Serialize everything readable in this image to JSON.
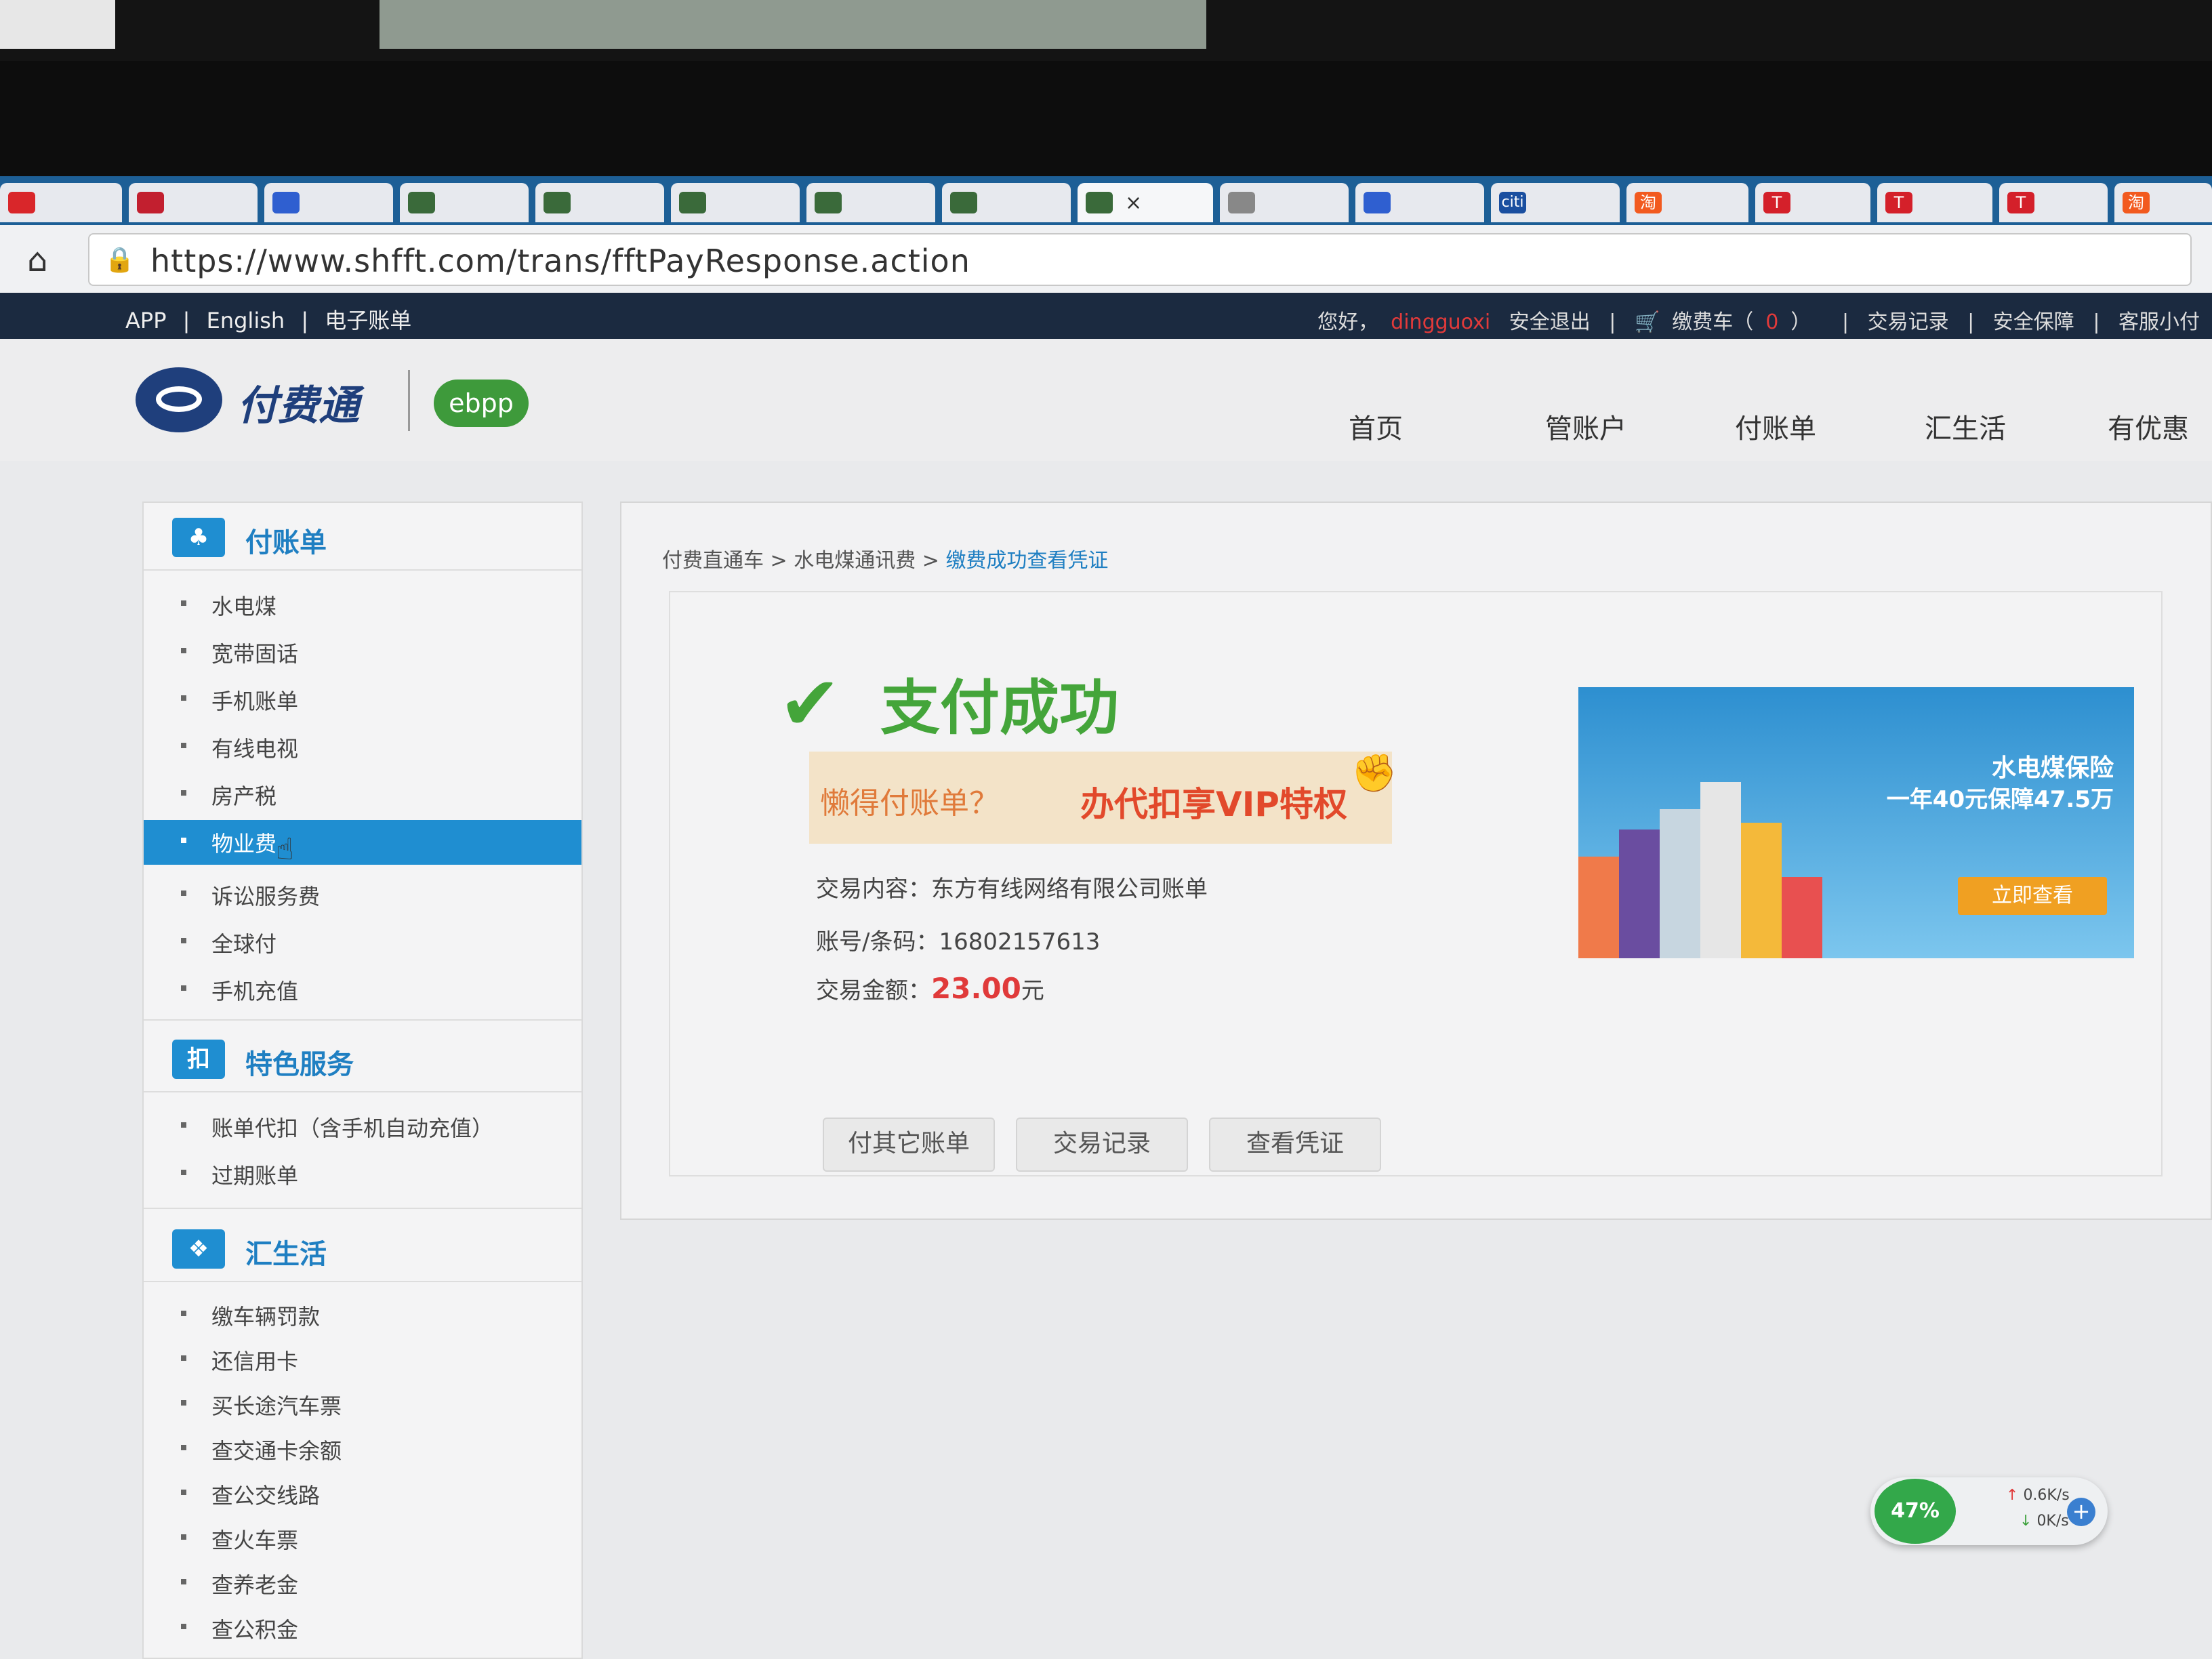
{
  "browser": {
    "tabs": [
      {
        "icon": "red-c-icon",
        "color": "#d9262a"
      },
      {
        "icon": "shield-icon",
        "color": "#c21f2f"
      },
      {
        "icon": "paw-icon",
        "color": "#2f5fd0"
      },
      {
        "icon": "train-icon",
        "color": "#3a6a3a"
      },
      {
        "icon": "train-icon",
        "color": "#3a6a3a"
      },
      {
        "icon": "train-icon",
        "color": "#3a6a3a"
      },
      {
        "icon": "train-icon",
        "color": "#3a6a3a"
      },
      {
        "icon": "train-icon",
        "color": "#3a6a3a"
      },
      {
        "icon": "train-icon",
        "color": "#3a6a3a",
        "active": true
      },
      {
        "icon": "document-icon",
        "color": "#888888"
      },
      {
        "icon": "paw-icon",
        "color": "#2f5fd0"
      },
      {
        "icon": "citi-icon",
        "color": "#1a4fa0",
        "text": "citi"
      },
      {
        "icon": "taobao-icon",
        "color": "#f25a1f",
        "text": "淘"
      },
      {
        "icon": "tmall-icon",
        "color": "#d4202a",
        "text": "T"
      },
      {
        "icon": "tmall-icon",
        "color": "#d4202a",
        "text": "T"
      },
      {
        "icon": "tmall-icon",
        "color": "#d4202a",
        "text": "T"
      },
      {
        "icon": "taobao-icon",
        "color": "#f25a1f",
        "text": "淘"
      }
    ],
    "url": "https://www.shfft.com/trans/fftPayResponse.action"
  },
  "sitebar": {
    "left": [
      "APP",
      "|",
      "English",
      "|",
      "电子账单"
    ],
    "greeting": "您好，",
    "username": "dingguoxi",
    "logout": "安全退出",
    "cart": "缴费车（",
    "cart_count": "0",
    "cart_close": "）",
    "records": "交易记录",
    "security": "安全保障",
    "service": "客服小付"
  },
  "header": {
    "logo_text": "付费通",
    "ebpp": "ebpp",
    "nav": [
      "首页",
      "管账户",
      "付账单",
      "汇生活",
      "有优惠"
    ]
  },
  "sidebar": {
    "sections": [
      {
        "title": "付账单",
        "icon_text": "",
        "items": [
          "水电煤",
          "宽带固话",
          "手机账单",
          "有线电视",
          "房产税",
          "物业费",
          "诉讼服务费",
          "全球付",
          "手机充值"
        ],
        "active_index": 5
      },
      {
        "title": "特色服务",
        "icon_text": "扣",
        "items": [
          "账单代扣（含手机自动充值）",
          "过期账单"
        ]
      },
      {
        "title": "汇生活",
        "icon_text": "",
        "items": [
          "缴车辆罚款",
          "还信用卡",
          "买长途汽车票",
          "查交通卡余额",
          "查公交线路",
          "查火车票",
          "查养老金",
          "查公积金"
        ]
      }
    ]
  },
  "content": {
    "breadcrumb": [
      "付费直通车",
      " > ",
      "水电煤通讯费",
      " > ",
      "缴费成功查看凭证"
    ],
    "success_title": "支付成功",
    "promo_question": "懒得付账单？",
    "promo_offer": "办代扣享VIP特权",
    "info": {
      "content_label": "交易内容：",
      "content_value": "东方有线网络有限公司账单",
      "account_label": "账号/条码：",
      "account_value": "16802157613",
      "amount_label": "交易金额：",
      "amount_value": "23.00",
      "amount_unit": "元"
    },
    "buttons": [
      "付其它账单",
      "交易记录",
      "查看凭证"
    ],
    "ad": {
      "title": "水电煤保险",
      "subtitle": "一年40元保障47.5万",
      "cta": "立即查看"
    }
  },
  "speed_widget": {
    "percent": "47%",
    "up": "0.6K/s",
    "down": "0K/s"
  },
  "colors": {
    "accent_blue": "#1f8ed1",
    "success_green": "#44a53a",
    "amount_red": "#e03a3a",
    "sitebar_bg": "#1b2a40"
  }
}
